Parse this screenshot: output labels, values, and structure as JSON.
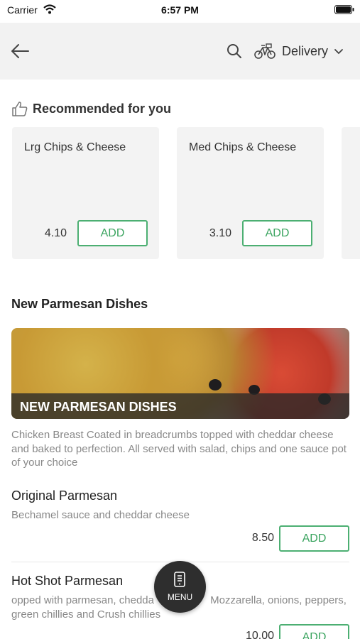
{
  "status_bar": {
    "carrier": "Carrier",
    "time": "6:57 PM"
  },
  "header": {
    "delivery_label": "Delivery"
  },
  "recommended": {
    "title": "Recommended for you",
    "items": [
      {
        "name": "Lrg Chips & Cheese",
        "price": "4.10",
        "button": "ADD"
      },
      {
        "name": "Med Chips & Cheese",
        "price": "3.10",
        "button": "ADD"
      }
    ]
  },
  "category": {
    "title": "New Parmesan Dishes",
    "banner_text": "NEW PARMESAN DISHES",
    "description": "Chicken Breast Coated in breadcrumbs topped with cheddar cheese and baked to perfection. All served with salad, chips and one sauce pot of your choice",
    "items": [
      {
        "name": "Original Parmesan",
        "description": "Bechamel sauce and cheddar cheese",
        "price": "8.50",
        "button": "ADD"
      },
      {
        "name": "Hot Shot Parmesan",
        "description": "opped with parmesan, chedda                   Mozzarella, onions, peppers, green chillies and Crush chillies",
        "price": "10.00",
        "button": "ADD"
      }
    ]
  },
  "fab": {
    "label": "MENU"
  },
  "colors": {
    "accent": "#4caf72",
    "topbar": "#f2f2f2",
    "card": "#f3f3f3",
    "fab": "#2e2e2e"
  },
  "icons": [
    "wifi-icon",
    "battery-icon",
    "back-arrow-icon",
    "search-icon",
    "bicycle-icon",
    "chevron-down-icon",
    "thumbs-up-icon",
    "phone-icon"
  ]
}
